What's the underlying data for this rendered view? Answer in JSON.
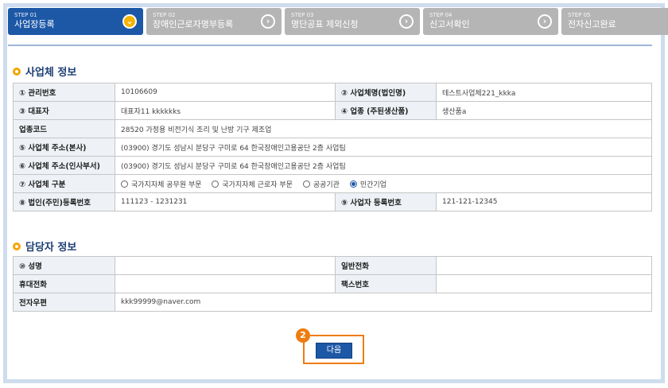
{
  "steps": [
    {
      "num": "STEP 01",
      "label": "사업장등록",
      "active": true,
      "icon": "check-circle-icon",
      "glyph": "⌄"
    },
    {
      "num": "STEP 02",
      "label": "장애인근로자명부등록",
      "active": false,
      "icon": "chevron-right-circle-icon",
      "glyph": "›"
    },
    {
      "num": "STEP 03",
      "label": "명단공표 제외신청",
      "active": false,
      "icon": "chevron-right-circle-icon",
      "glyph": "›"
    },
    {
      "num": "STEP 04",
      "label": "신고서확인",
      "active": false,
      "icon": "chevron-right-circle-icon",
      "glyph": "›"
    },
    {
      "num": "STEP 05",
      "label": "전자신고완료",
      "active": false,
      "icon": "document-edit-icon",
      "glyph": ""
    }
  ],
  "company": {
    "title": "사업체 정보",
    "mgmt_no_label": "① 관리번호",
    "mgmt_no": "10106609",
    "biz_name_label": "② 사업체명(법인명)",
    "biz_name": "테스트사업체221_kkka",
    "ceo_label": "③ 대표자",
    "ceo": "대표자11 kkkkkks",
    "industry_label": "④ 업종 (주된생산품)",
    "industry": "생산품a",
    "industry_code_label": "업종코드",
    "industry_code": "28520 가정용 비전기식 조리 및 난방 기구 제조업",
    "hq_addr_label": "⑤ 사업체 주소(본사)",
    "hq_addr": "(03900) 경기도 성남시 분당구 구미로 64 한국장애인고용공단 2층 사업팀",
    "hr_addr_label": "⑥ 사업체 주소(인사부서)",
    "hr_addr": "(03900) 경기도 성남시 분당구 구미로 64 한국장애인고용공단 2층 사업팀",
    "biz_type_label": "⑦ 사업체 구분",
    "biz_type_options": [
      {
        "label": "국가지자체 공무원 부문",
        "checked": false
      },
      {
        "label": "국가지자체 근로자 부문",
        "checked": false
      },
      {
        "label": "공공기관",
        "checked": false
      },
      {
        "label": "민간기업",
        "checked": true
      }
    ],
    "corp_reg_label": "⑧ 법인(주민)등록번호",
    "corp_reg": "111123 - 1231231",
    "biz_reg_label": "⑨ 사업자 등록번호",
    "biz_reg": "121-121-12345"
  },
  "contact": {
    "title": "담당자 정보",
    "name_label": "⑩ 성명",
    "name": "",
    "phone_label": "일반전화",
    "phone": "",
    "mobile_label": "휴대전화",
    "mobile": "",
    "fax_label": "팩스번호",
    "fax": "",
    "email_label": "전자우편",
    "email": "kkk99999@naver.com"
  },
  "next_button": "다음",
  "badge": "2",
  "colors": {
    "primary": "#1d58a7",
    "accent": "#ee7d11",
    "inactive": "#b5b5b5",
    "header_bg": "#eef2f7"
  }
}
